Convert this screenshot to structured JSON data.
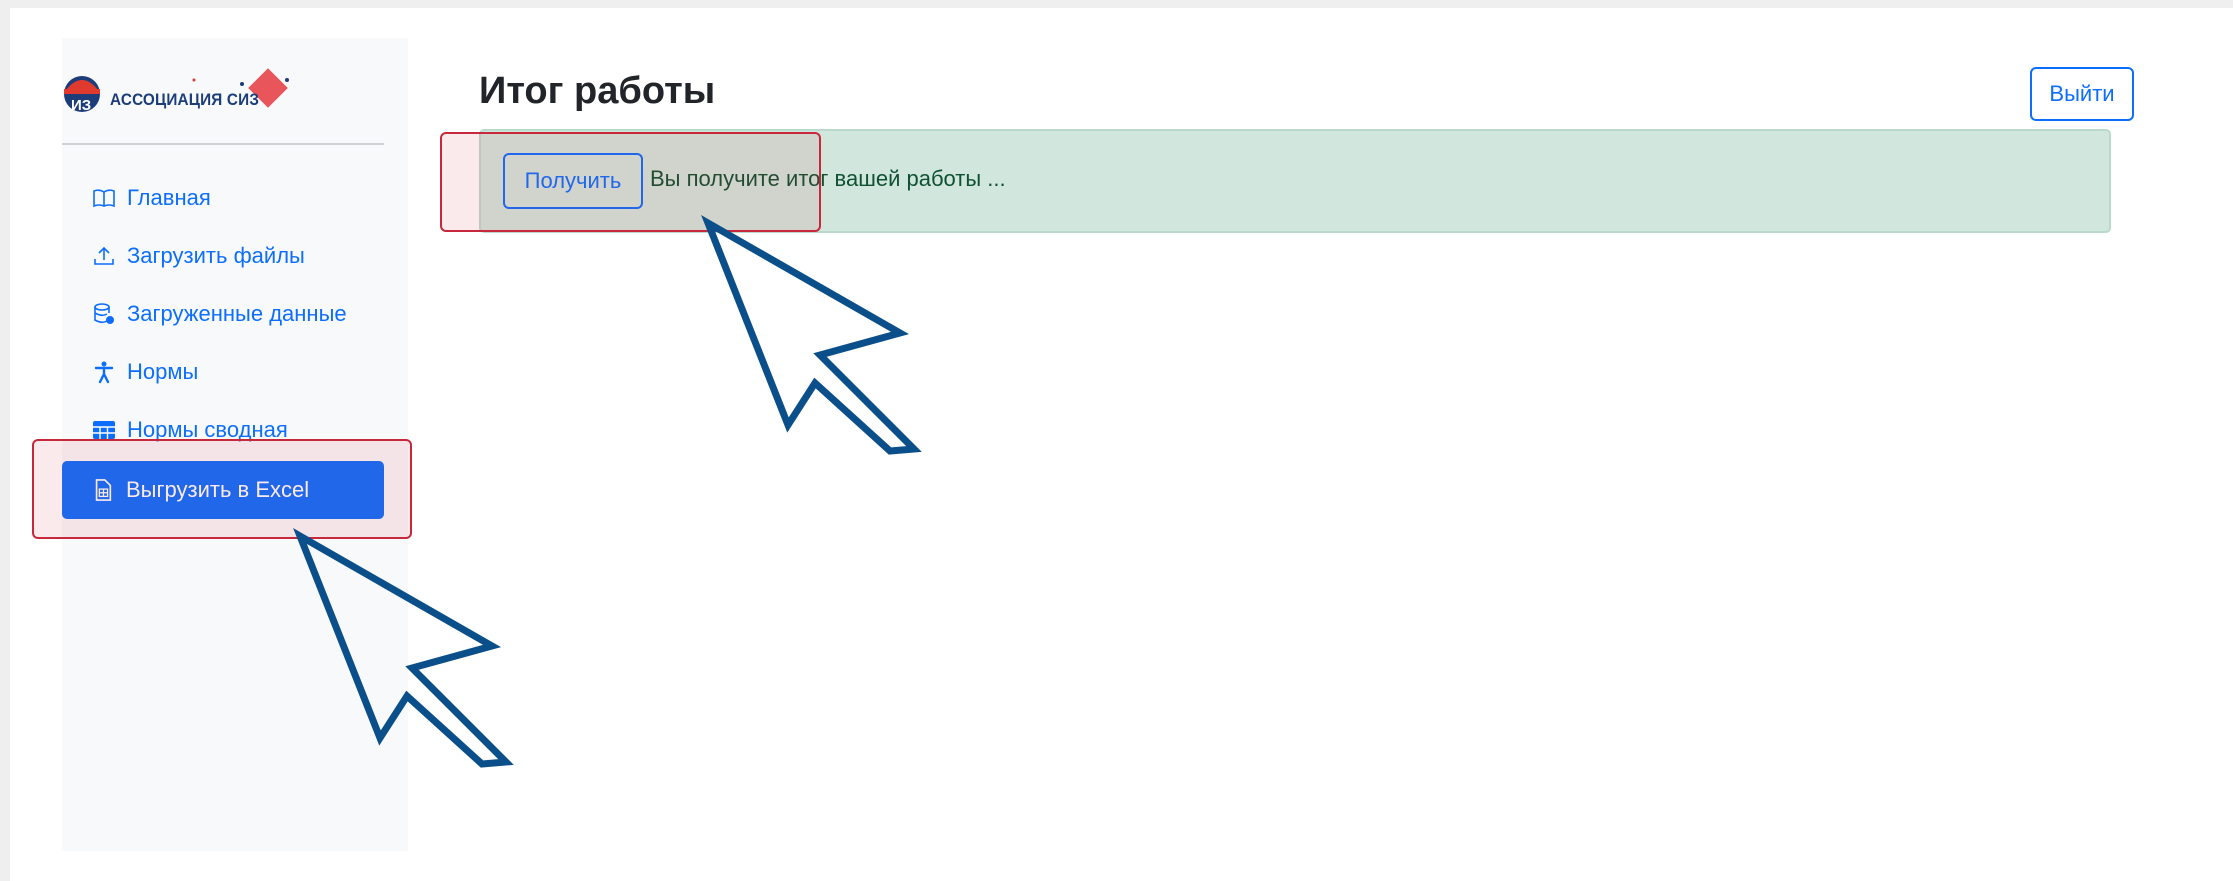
{
  "logo": {
    "text": "АССОЦИАЦИЯ СИЗ"
  },
  "sidebar": {
    "items": [
      {
        "label": "Главная",
        "icon": "book-icon"
      },
      {
        "label": "Загрузить файлы",
        "icon": "upload-icon"
      },
      {
        "label": "Загруженные данные",
        "icon": "database-icon"
      },
      {
        "label": "Нормы",
        "icon": "person-icon"
      },
      {
        "label": "Нормы сводная",
        "icon": "table-icon"
      },
      {
        "label": "Выгрузить в Excel",
        "icon": "spreadsheet-file-icon",
        "active": true
      }
    ]
  },
  "header": {
    "title": "Итог работы",
    "logout_label": "Выйти"
  },
  "alert": {
    "button_label": "Получить",
    "message": "Вы получите итог вашей работы ..."
  },
  "colors": {
    "accent": "#0d6efd",
    "alert_bg": "#d1e7dd",
    "highlight": "#c8283c",
    "pointer": "#0b4f8a"
  }
}
